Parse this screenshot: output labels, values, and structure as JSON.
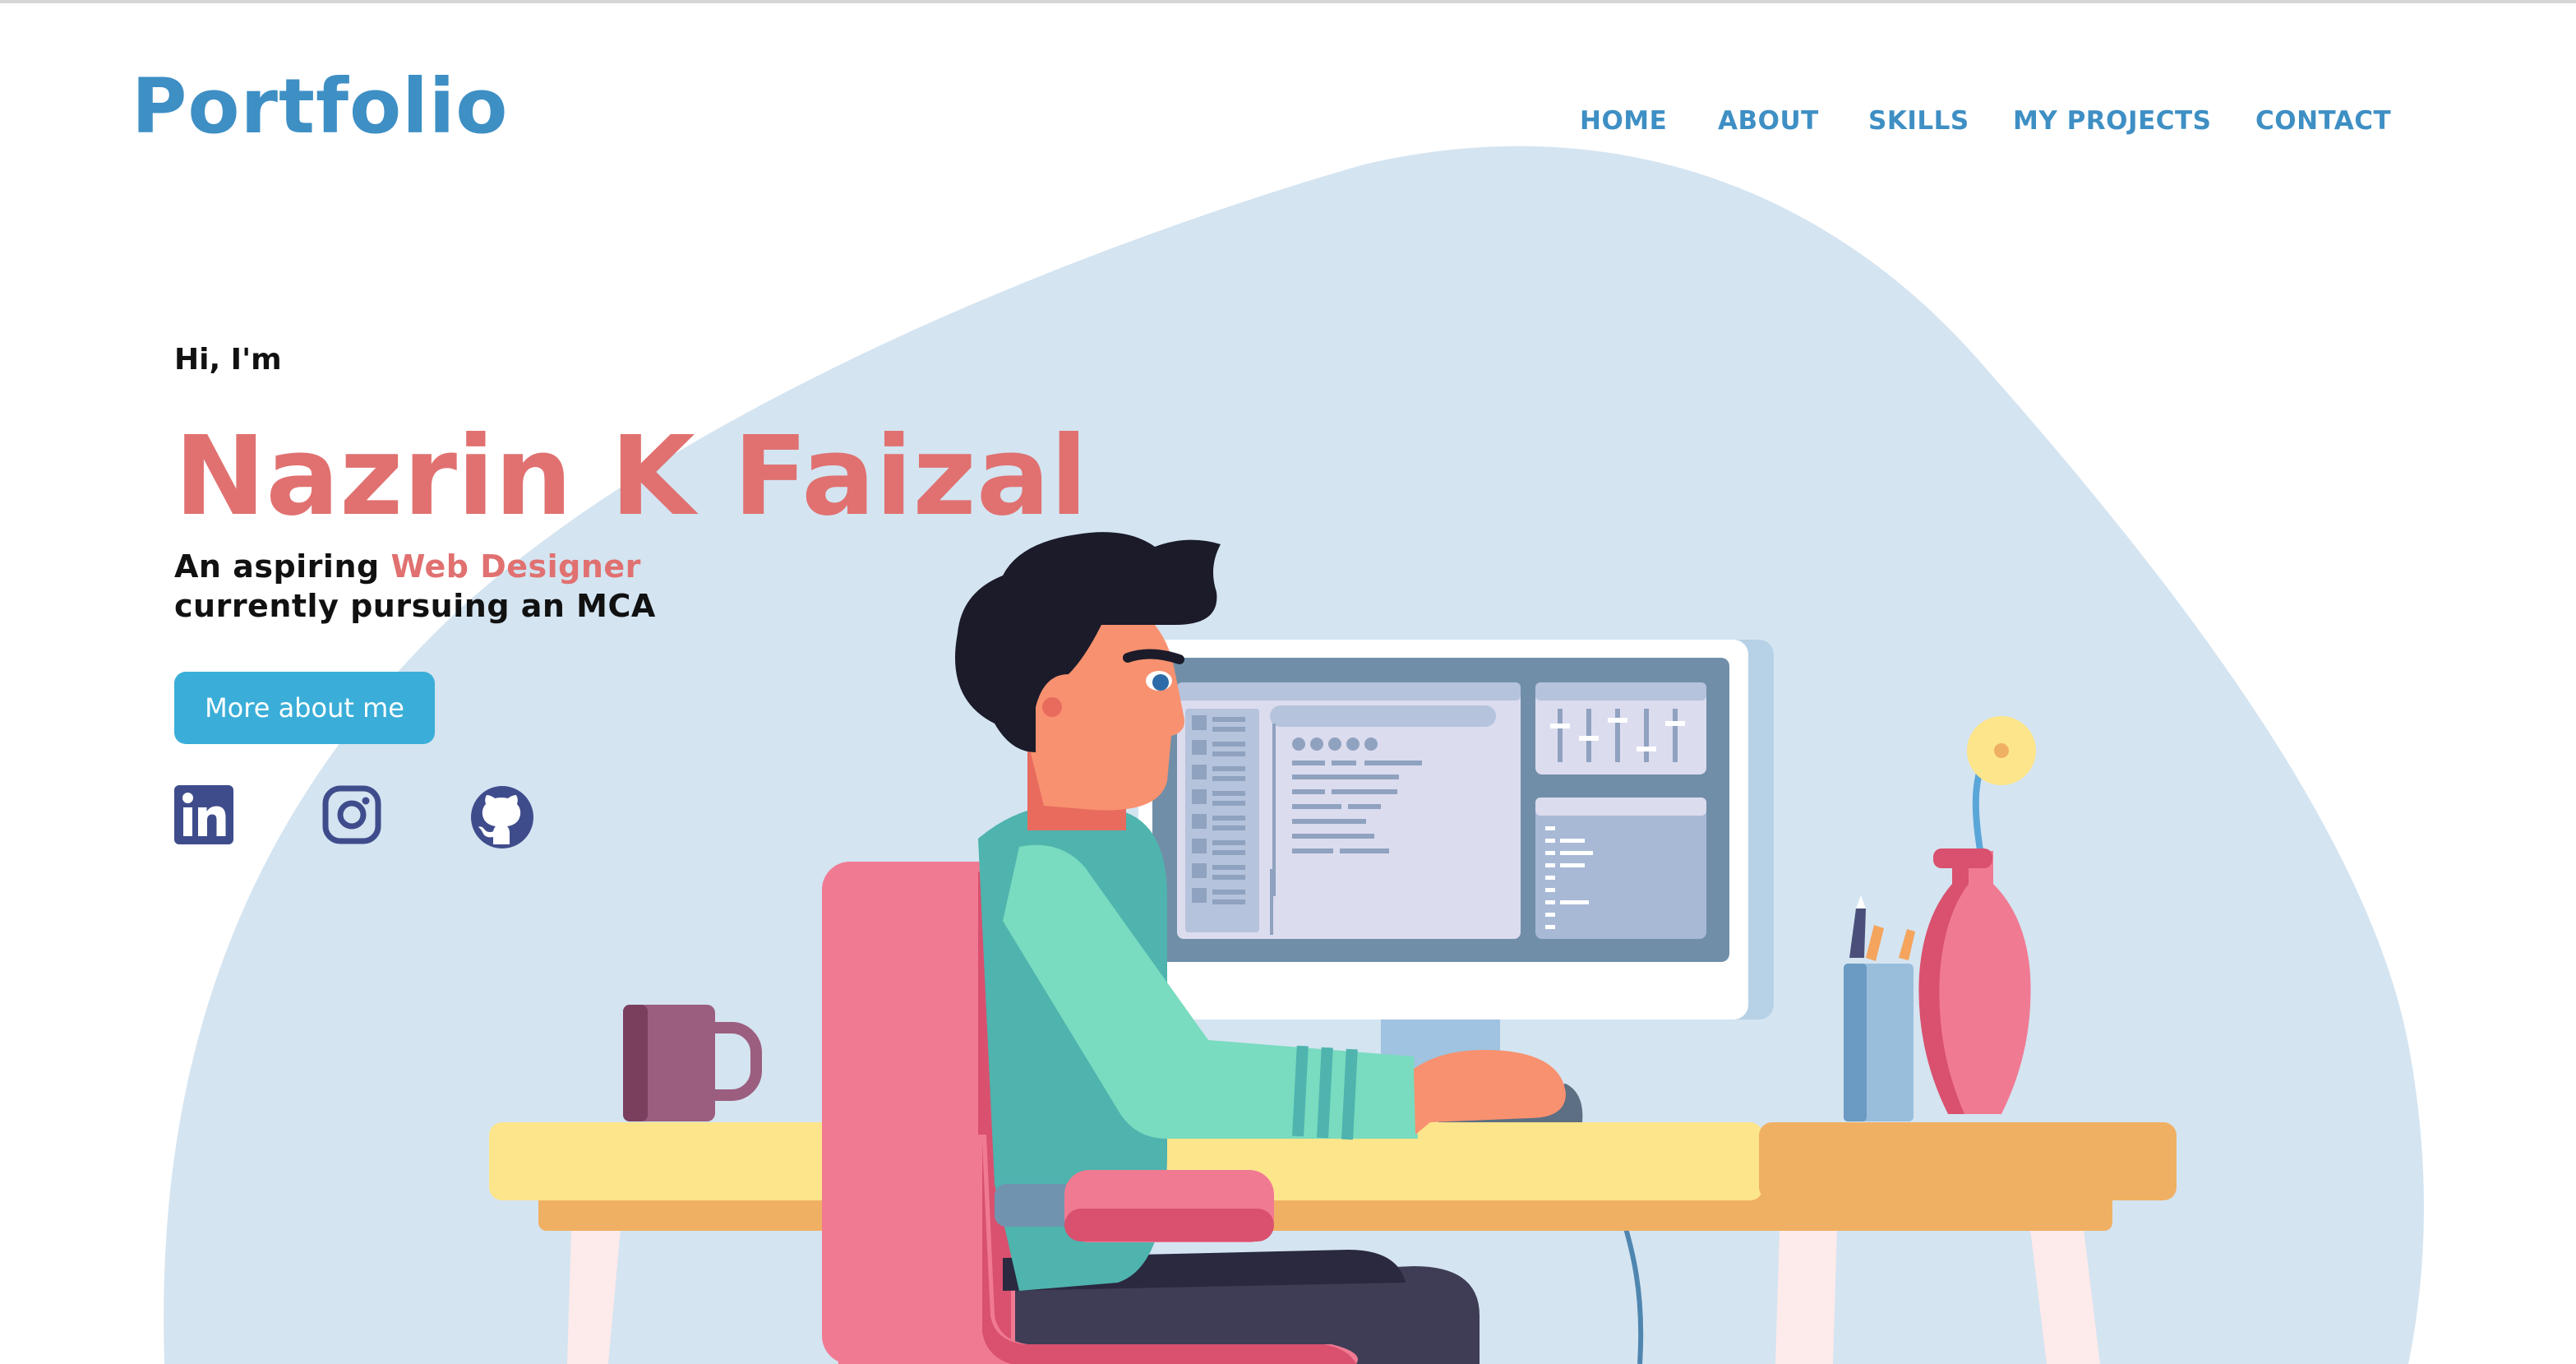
{
  "header": {
    "logo": "Portfolio"
  },
  "nav": {
    "items": [
      {
        "label": "HOME"
      },
      {
        "label": "ABOUT"
      },
      {
        "label": "SKILLS"
      },
      {
        "label": "MY PROJECTS"
      },
      {
        "label": "CONTACT"
      }
    ]
  },
  "hero": {
    "greeting": "Hi, I'm",
    "name": "Nazrin K Faizal",
    "tagline_prefix": "An aspiring ",
    "tagline_accent": "Web Designer",
    "tagline_line2": "currently pursuing an MCA",
    "cta_label": "More about me"
  },
  "socials": [
    {
      "icon": "linkedin-icon"
    },
    {
      "icon": "instagram-icon"
    },
    {
      "icon": "github-icon"
    }
  ],
  "colors": {
    "brand_blue": "#3e8fc4",
    "accent_pink": "#e07170",
    "button": "#3aaed8",
    "blob": "#d4e4f1",
    "social_icon": "#3f4c8c"
  }
}
